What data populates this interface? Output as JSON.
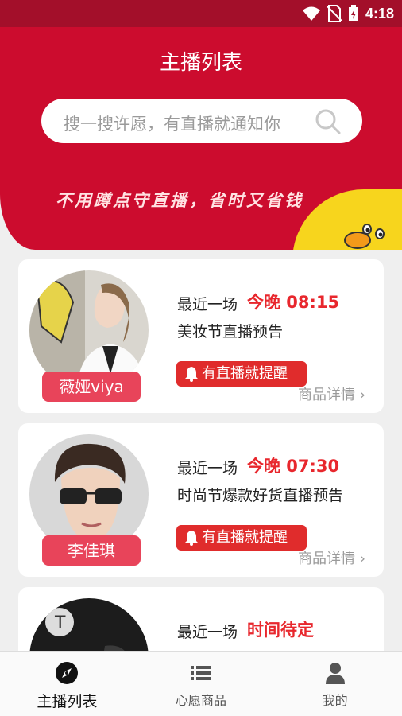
{
  "status_bar": {
    "time": "4:18"
  },
  "header": {
    "title": "主播列表",
    "search_placeholder": "搜一搜许愿，有直播就通知你",
    "slogan": "不用蹲点守直播，省时又省钱"
  },
  "cards": [
    {
      "name": "薇娅viya",
      "recent_label": "最近一场",
      "time": "今晚 08:15",
      "desc": "美妆节直播预告",
      "remind_label": "有直播就提醒",
      "detail_label": "商品详情 ›"
    },
    {
      "name": "李佳琪",
      "recent_label": "最近一场",
      "time": "今晚 07:30",
      "desc": "时尚节爆款好货直播预告",
      "remind_label": "有直播就提醒",
      "detail_label": "商品详情 ›"
    },
    {
      "name": "",
      "recent_label": "最近一场",
      "time": "时间待定",
      "desc": "",
      "remind_label": "",
      "detail_label": ""
    }
  ],
  "tabs": [
    {
      "label": "主播列表",
      "icon": "compass-icon",
      "active": true
    },
    {
      "label": "心愿商品",
      "icon": "list-icon",
      "active": false
    },
    {
      "label": "我的",
      "icon": "person-icon",
      "active": false
    }
  ],
  "colors": {
    "primary": "#cc0c2e",
    "accent": "#e02c2c",
    "pill": "#e8445a",
    "yellow": "#f7d51d"
  }
}
